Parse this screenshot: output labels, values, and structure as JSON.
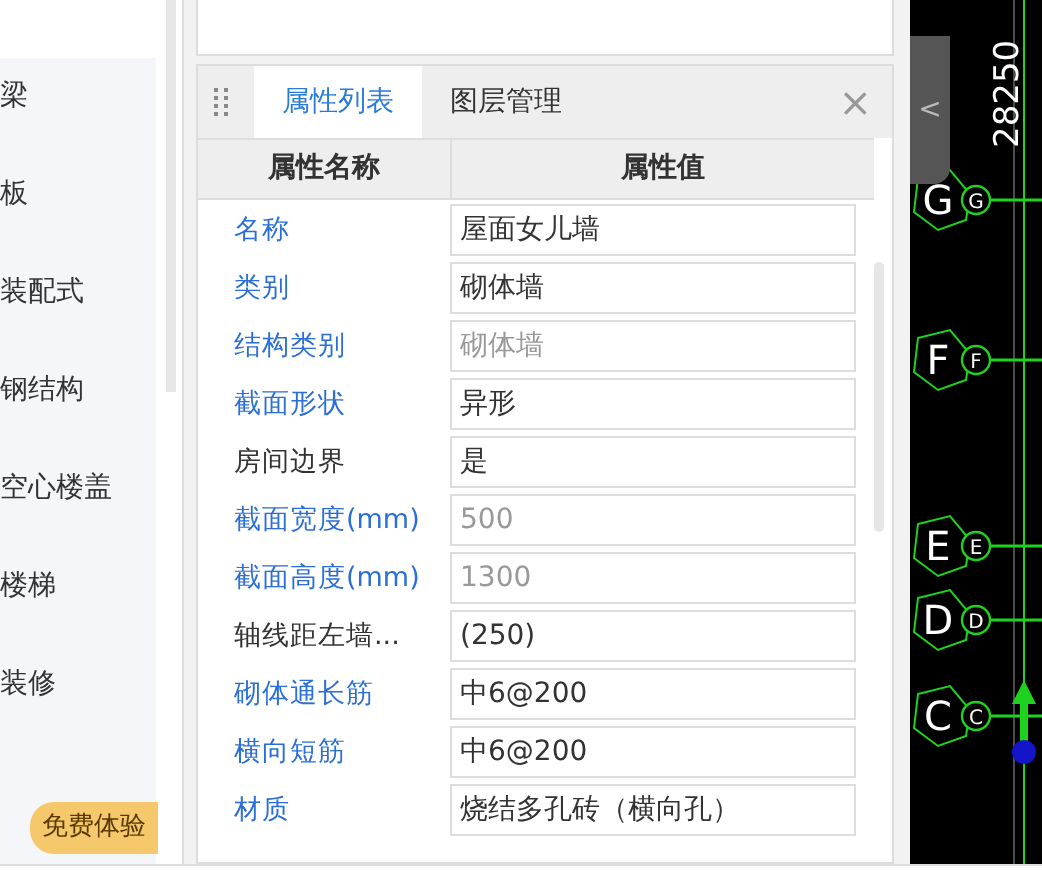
{
  "sidebar": {
    "items": [
      {
        "label": "梁"
      },
      {
        "label": "板"
      },
      {
        "label": "装配式"
      },
      {
        "label": "钢结构"
      },
      {
        "label": "空心楼盖"
      },
      {
        "label": "楼梯"
      },
      {
        "label": "装修"
      }
    ],
    "badge": "免费体验"
  },
  "panel": {
    "tabs": [
      {
        "label": "属性列表",
        "selected": true
      },
      {
        "label": "图层管理",
        "selected": false
      }
    ],
    "close": "×",
    "columns": [
      "属性名称",
      "属性值"
    ],
    "rows": [
      {
        "name": "名称",
        "value": "屋面女儿墙",
        "linked": true,
        "disabled": false
      },
      {
        "name": "类别",
        "value": "砌体墙",
        "linked": true,
        "disabled": false
      },
      {
        "name": "结构类别",
        "value": "砌体墙",
        "linked": true,
        "disabled": true
      },
      {
        "name": "截面形状",
        "value": "异形",
        "linked": true,
        "disabled": false
      },
      {
        "name": "房间边界",
        "value": "是",
        "linked": false,
        "disabled": false
      },
      {
        "name": "截面宽度(mm)",
        "value": "500",
        "linked": true,
        "disabled": true
      },
      {
        "name": "截面高度(mm)",
        "value": "1300",
        "linked": true,
        "disabled": true
      },
      {
        "name": "轴线距左墙...",
        "value": "(250)",
        "linked": false,
        "disabled": false
      },
      {
        "name": "砌体通长筋",
        "value": "中6@200",
        "linked": true,
        "disabled": false
      },
      {
        "name": "横向短筋",
        "value": "中6@200",
        "linked": true,
        "disabled": false
      },
      {
        "name": "材质",
        "value": "烧结多孔砖（横向孔）",
        "linked": true,
        "disabled": false
      }
    ]
  },
  "canvas": {
    "collapse": "<",
    "dimension": "28250",
    "axes": [
      {
        "label": "G",
        "tag": "G"
      },
      {
        "label": "F",
        "tag": "F"
      },
      {
        "label": "E",
        "tag": "E"
      },
      {
        "label": "D",
        "tag": "D"
      },
      {
        "label": "C",
        "tag": "C"
      }
    ]
  }
}
